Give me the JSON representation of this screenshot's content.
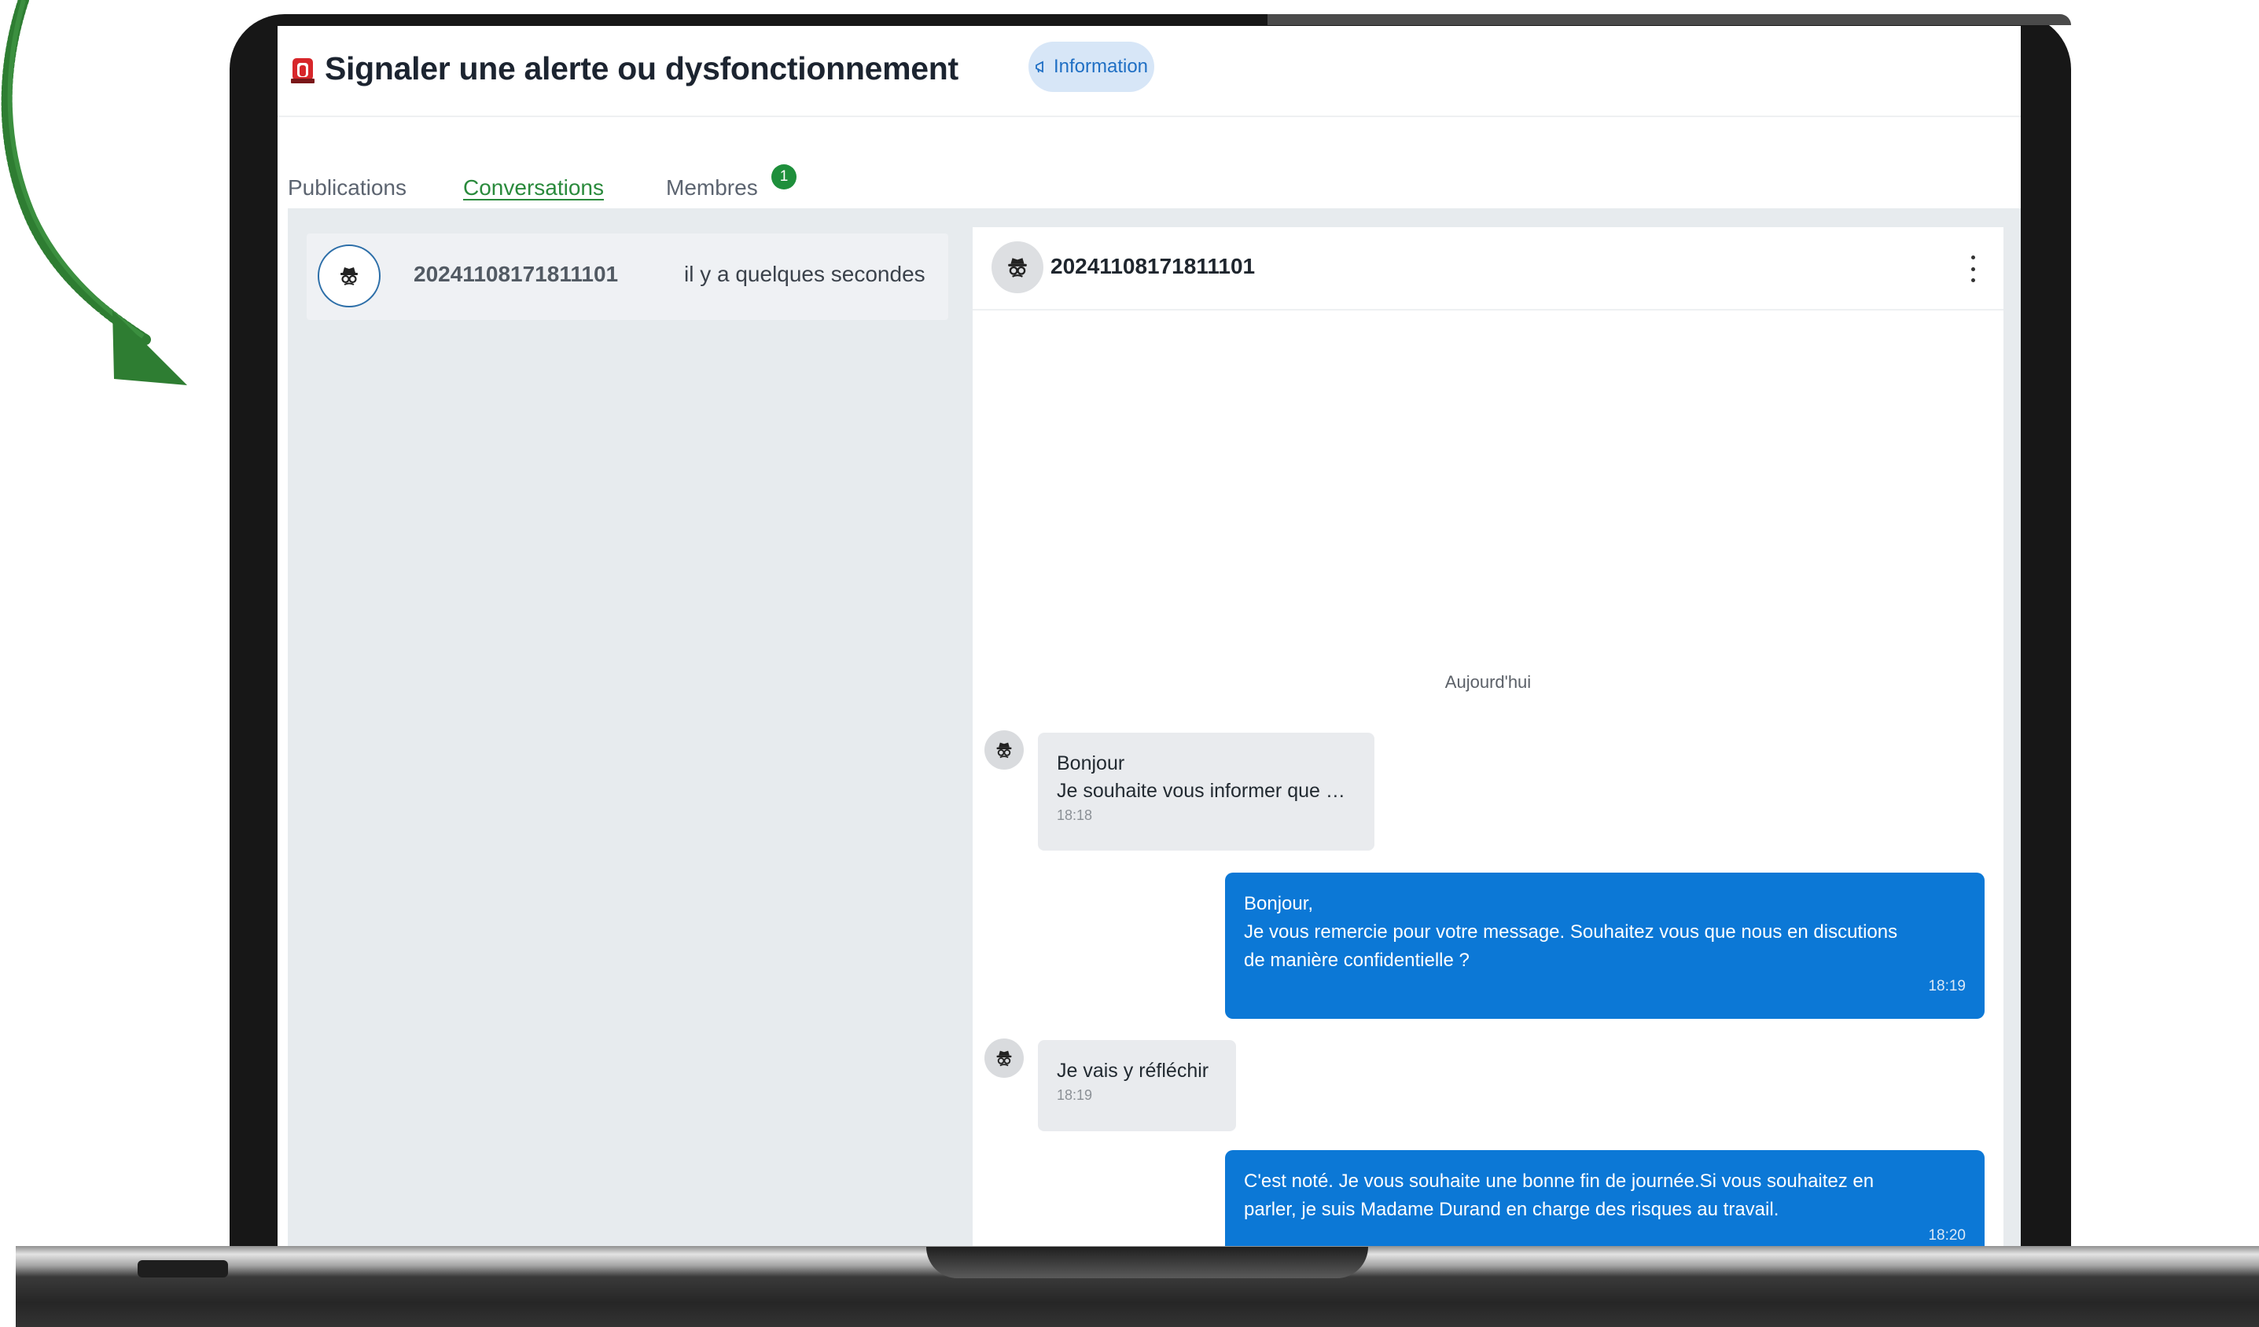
{
  "page": {
    "title": "Signaler une alerte ou dysfonctionnement",
    "info_badge": "Information"
  },
  "tabs": [
    {
      "label": "Publications",
      "active": false
    },
    {
      "label": "Conversations",
      "active": true
    },
    {
      "label": "Membres",
      "active": false,
      "count": "1"
    }
  ],
  "conversations": [
    {
      "name": "20241108171811101",
      "time": "il y a quelques secondes",
      "icon": "incognito-icon"
    }
  ],
  "chat": {
    "title": "20241108171811101",
    "date_separator": "Aujourd'hui",
    "messages": [
      {
        "direction": "in",
        "lines": [
          "Bonjour",
          "Je souhaite vous informer que …"
        ],
        "time": "18:18"
      },
      {
        "direction": "out",
        "lines": [
          "Bonjour,",
          "Je vous remercie pour votre message. Souhaitez vous que nous en discutions",
          "de manière confidentielle ?"
        ],
        "time": "18:19"
      },
      {
        "direction": "in",
        "lines": [
          "Je vais y réfléchir"
        ],
        "time": "18:19"
      },
      {
        "direction": "out",
        "lines": [
          "C'est noté. Je vous souhaite une bonne fin de journée.Si vous souhaitez en",
          "parler, je suis Madame Durand en charge des risques au travail."
        ],
        "time": "18:20"
      }
    ]
  },
  "colors": {
    "accent_green": "#2a8a3c",
    "outgoing_bubble": "#0c78d6",
    "incoming_bubble": "#e9ebee",
    "content_bg": "#e7ebee",
    "arrow_green": "#2e7d32"
  }
}
